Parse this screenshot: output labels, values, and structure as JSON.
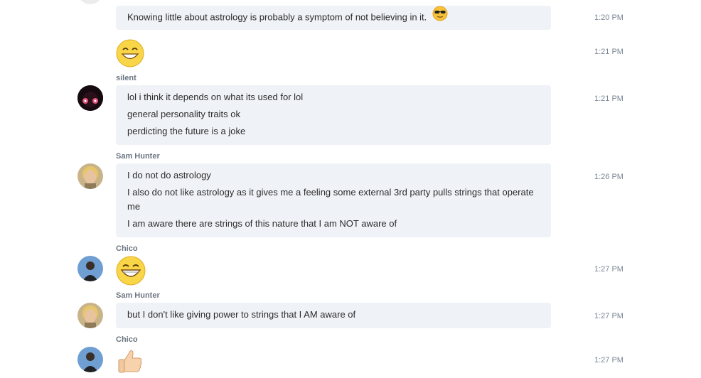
{
  "messages": [
    {
      "time": "1:20 PM",
      "lines": [
        "Knowing little about astrology is probably a symptom of not believing in it."
      ],
      "emoji": "cool-sunglasses-icon"
    },
    {
      "time": "1:21 PM",
      "emoji": "grinning-face-icon"
    },
    {
      "sender": "silent",
      "time": "1:21 PM",
      "lines": [
        "lol i think it depends on what its used for lol",
        "general personality traits ok",
        "perdicting the future  is a joke"
      ]
    },
    {
      "sender": "Sam Hunter",
      "time": "1:26 PM",
      "lines": [
        "I do not do astrology",
        "I also do not like astrology as it gives me a feeling some external 3rd party pulls strings that operate me",
        "I am aware there are strings of this nature that I am NOT aware of"
      ]
    },
    {
      "sender": "Chico",
      "time": "1:27 PM",
      "emoji": "big-grin-icon"
    },
    {
      "sender": "Sam Hunter",
      "time": "1:27 PM",
      "lines": [
        "but I don't like giving power to strings that I AM aware of"
      ]
    },
    {
      "sender": "Chico",
      "time": "1:27 PM",
      "emoji": "thumbs-up-icon"
    }
  ],
  "colors": {
    "bubble": "#eff2f7",
    "time": "#7a8594",
    "sender": "#6b7480",
    "text": "#2c2c2c"
  }
}
